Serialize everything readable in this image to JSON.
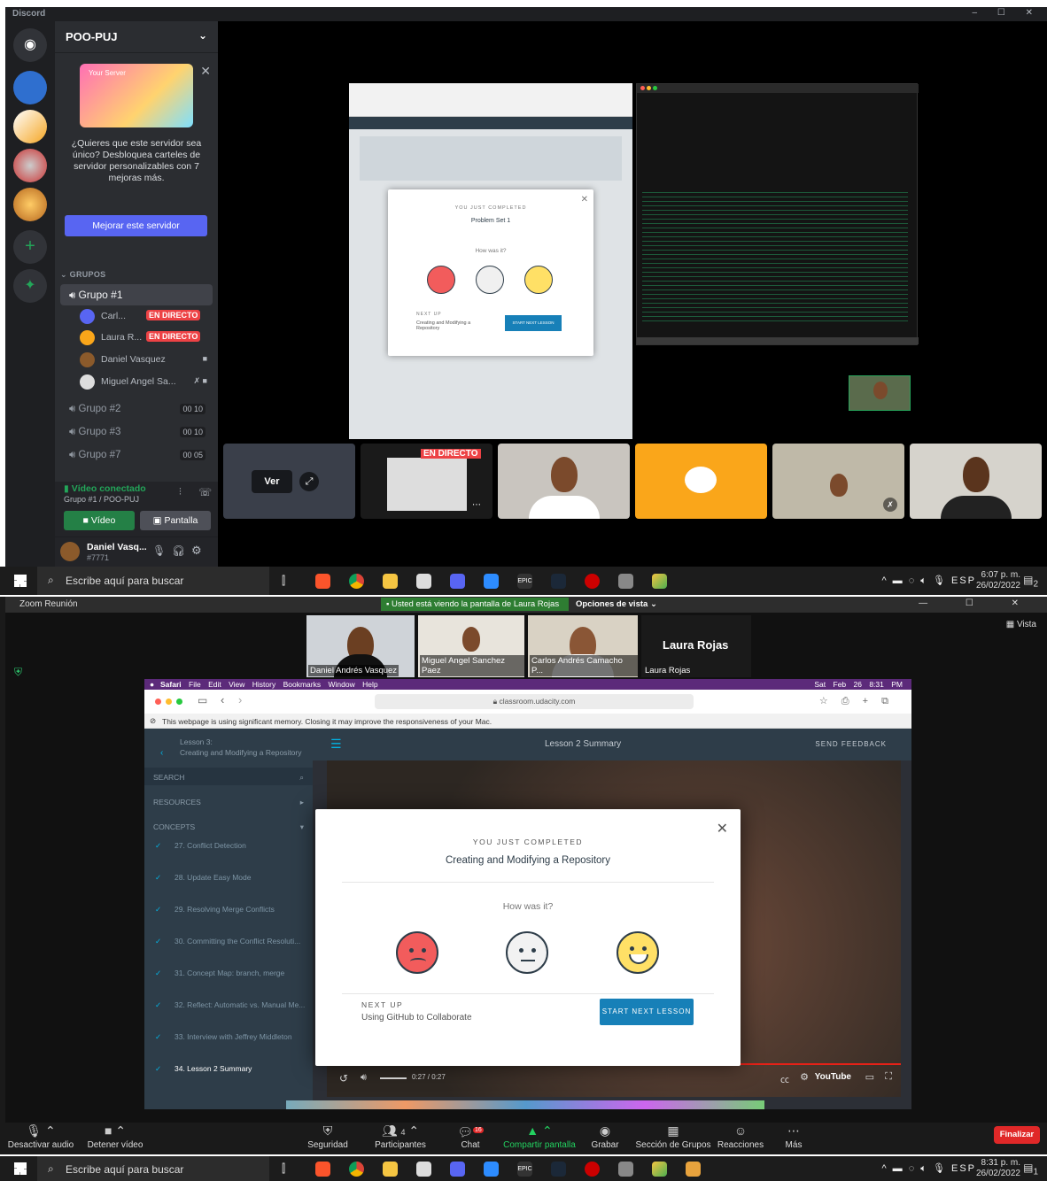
{
  "discord": {
    "title": "Discord",
    "server_name": "POO-PUJ",
    "promo": {
      "label": "Your Server",
      "text": "¿Quieres que este servidor sea único? Desbloquea carteles de servidor personalizables con 7 mejoras más.",
      "button": "Mejorar este servidor"
    },
    "category": "GRUPOS",
    "channels": [
      {
        "name": "Grupo #1"
      },
      {
        "name": "Grupo #2",
        "count": "00 10"
      },
      {
        "name": "Grupo #3",
        "count": "00 10"
      },
      {
        "name": "Grupo #7",
        "count": "00 05"
      }
    ],
    "users": [
      {
        "name": "Carl...",
        "live": "EN DIRECTO"
      },
      {
        "name": "Laura R...",
        "live": "EN DIRECTO"
      },
      {
        "name": "Daniel Vasquez"
      },
      {
        "name": "Miguel Angel Sa..."
      }
    ],
    "voice": {
      "status": "Vídeo conectado",
      "location": "Grupo #1 / POO-PUJ",
      "video_btn": "Vídeo",
      "screen_btn": "Pantalla"
    },
    "me": {
      "name": "Daniel Vasq...",
      "tag": "#7771"
    },
    "stage": {
      "modal_kicker": "YOU JUST COMPLETED",
      "modal_title": "Problem Set 1",
      "how": "How was it?",
      "next_kicker": "NEXT UP",
      "next_title": "Creating and Modifying a Repository",
      "next_btn": "START NEXT LESSON",
      "ver": "Ver",
      "live": "EN DIRECTO"
    }
  },
  "taskbar_top": {
    "search": "Escribe aquí para buscar",
    "lang": "ESP",
    "time": "6:07 p. m.",
    "date": "26/02/2022",
    "badge": "2"
  },
  "zoom": {
    "title": "Zoom Reunión",
    "banner": "Usted está viendo la pantalla de Laura Rojas",
    "view_options": "Opciones de vista",
    "vista": "Vista",
    "participants": [
      {
        "name": "Daniel Andrés Vasquez"
      },
      {
        "name": "Miguel Angel Sanchez Paez"
      },
      {
        "name": "Carlos Andrés Camacho P..."
      },
      {
        "name": "Laura Rojas",
        "big": "Laura Rojas"
      }
    ],
    "mac_menu": [
      "Safari",
      "File",
      "Edit",
      "View",
      "History",
      "Bookmarks",
      "Window",
      "Help"
    ],
    "mac_clock": "Sat Feb 26  8:31 PM",
    "url": "classroom.udacity.com",
    "mem_warning": "This webpage is using significant memory. Closing it may improve the responsiveness of your Mac.",
    "lesson_kicker": "Lesson 3:",
    "lesson_title": "Creating and Modifying a Repository",
    "search": "SEARCH",
    "resources": "RESOURCES",
    "concepts": "CONCEPTS",
    "concept_list": [
      "27. Conflict Detection",
      "28. Update Easy Mode",
      "29. Resolving Merge Conflicts",
      "30. Committing the Conflict Resoluti...",
      "31. Concept Map: branch, merge",
      "32. Reflect: Automatic vs. Manual Me...",
      "33. Interview with Jeffrey Middleton",
      "34. Lesson 2 Summary"
    ],
    "page_title": "Lesson 2 Summary",
    "send_feedback": "SEND FEEDBACK",
    "modal": {
      "kicker": "YOU JUST COMPLETED",
      "title": "Creating and Modifying a Repository",
      "how": "How was it?",
      "next_kicker": "NEXT UP",
      "next_title": "Using GitHub to Collaborate",
      "next_btn": "START NEXT LESSON"
    },
    "video_time": "0:27 / 0:27",
    "youtube": "YouTube",
    "controls": [
      {
        "label": "Desactivar audio"
      },
      {
        "label": "Detener vídeo"
      },
      {
        "label": "Seguridad"
      },
      {
        "label": "Participantes",
        "count": "4"
      },
      {
        "label": "Chat",
        "count": "16"
      },
      {
        "label": "Compartir pantalla"
      },
      {
        "label": "Grabar"
      },
      {
        "label": "Sección de Grupos"
      },
      {
        "label": "Reacciones"
      },
      {
        "label": "Más"
      }
    ],
    "end_btn": "Finalizar"
  },
  "taskbar_bottom": {
    "search": "Escribe aquí para buscar",
    "lang": "ESP",
    "time": "8:31 p. m.",
    "date": "26/02/2022",
    "badge": "1"
  },
  "colors": {
    "discord_bg": "#1e1f22",
    "blurple": "#5865f2",
    "live_red": "#ed4245",
    "udacity_blue": "#02b3e4",
    "zoom_green": "#2e7d32"
  }
}
